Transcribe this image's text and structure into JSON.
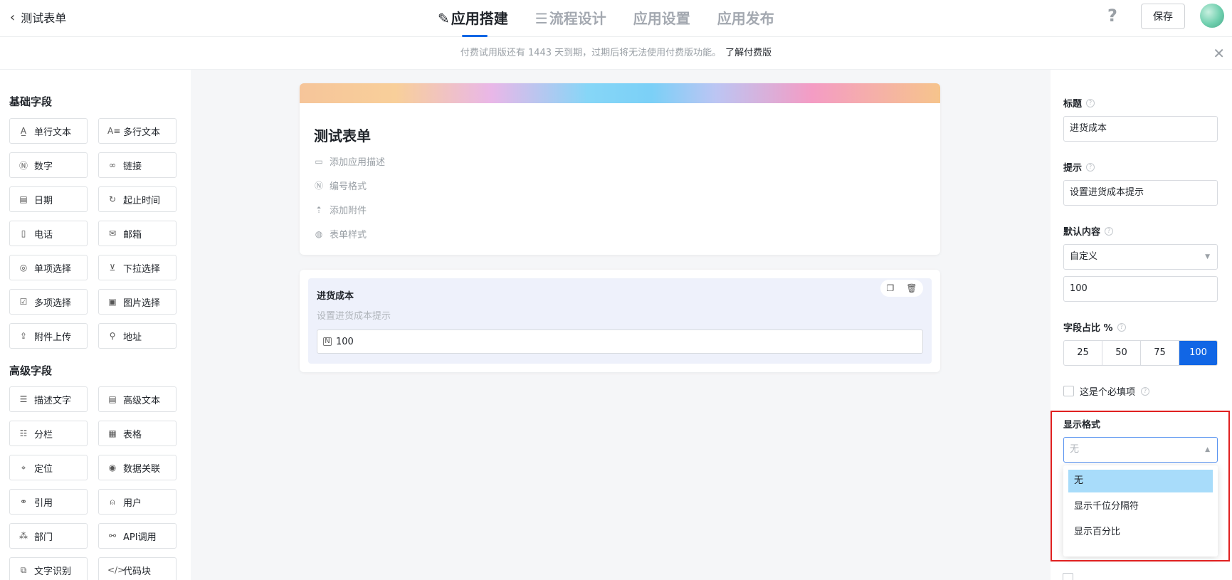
{
  "header": {
    "back_label": "测试表单",
    "tabs": [
      {
        "label": "应用搭建",
        "active": true,
        "icon": "edit-icon"
      },
      {
        "label": "流程设计",
        "active": false,
        "icon": "flow-icon"
      },
      {
        "label": "应用设置",
        "active": false
      },
      {
        "label": "应用发布",
        "active": false
      }
    ],
    "help_label": "?",
    "save_label": "保存"
  },
  "notice": {
    "text": "付费试用版还有 1443 天到期，过期后将无法使用付费版功能。",
    "link": "了解付费版"
  },
  "left_panel": {
    "basic_title": "基础字段",
    "basic_fields": [
      {
        "label": "单行文本",
        "icon": "single-line-text-icon",
        "glyph": "A̲"
      },
      {
        "label": "多行文本",
        "icon": "multi-line-text-icon",
        "glyph": "A≡"
      },
      {
        "label": "数字",
        "icon": "number-icon",
        "glyph": "Ⓝ"
      },
      {
        "label": "链接",
        "icon": "link-icon",
        "glyph": "🔗"
      },
      {
        "label": "日期",
        "icon": "calendar-icon",
        "glyph": "▤"
      },
      {
        "label": "起止时间",
        "icon": "time-range-icon",
        "glyph": "↻"
      },
      {
        "label": "电话",
        "icon": "phone-icon",
        "glyph": "▯"
      },
      {
        "label": "邮箱",
        "icon": "mail-icon",
        "glyph": "✉"
      },
      {
        "label": "单项选择",
        "icon": "radio-icon",
        "glyph": "◎"
      },
      {
        "label": "下拉选择",
        "icon": "dropdown-icon",
        "glyph": "⊻"
      },
      {
        "label": "多项选择",
        "icon": "checkbox-icon",
        "glyph": "☑"
      },
      {
        "label": "图片选择",
        "icon": "image-icon",
        "glyph": "▣"
      },
      {
        "label": "附件上传",
        "icon": "upload-icon",
        "glyph": "⇪"
      },
      {
        "label": "地址",
        "icon": "location-pin-icon",
        "glyph": "⚲"
      }
    ],
    "advanced_title": "高级字段",
    "advanced_fields": [
      {
        "label": "描述文字",
        "icon": "description-icon",
        "glyph": "☰"
      },
      {
        "label": "高级文本",
        "icon": "rich-text-icon",
        "glyph": "▤"
      },
      {
        "label": "分栏",
        "icon": "columns-icon",
        "glyph": "☷"
      },
      {
        "label": "表格",
        "icon": "table-icon",
        "glyph": "▦"
      },
      {
        "label": "定位",
        "icon": "locate-icon",
        "glyph": "⌖"
      },
      {
        "label": "数据关联",
        "icon": "data-link-icon",
        "glyph": "◉"
      },
      {
        "label": "引用",
        "icon": "reference-icon",
        "glyph": "⚭"
      },
      {
        "label": "用户",
        "icon": "user-icon",
        "glyph": "⍝"
      },
      {
        "label": "部门",
        "icon": "department-icon",
        "glyph": "⁂"
      },
      {
        "label": "API调用",
        "icon": "api-icon",
        "glyph": "⚯"
      },
      {
        "label": "文字识别",
        "icon": "ocr-icon",
        "glyph": "⧉"
      },
      {
        "label": "代码块",
        "icon": "code-icon",
        "glyph": "</>"
      }
    ]
  },
  "form": {
    "title": "测试表单",
    "meta": [
      {
        "label": "添加应用描述",
        "icon": "comment-icon",
        "glyph": "▭"
      },
      {
        "label": "编号格式",
        "icon": "number-format-icon",
        "glyph": "Ⓝ"
      },
      {
        "label": "添加附件",
        "icon": "attach-upload-icon",
        "glyph": "⇡"
      },
      {
        "label": "表单样式",
        "icon": "palette-icon",
        "glyph": "◍"
      }
    ],
    "field": {
      "label": "进货成本",
      "hint": "设置进货成本提示",
      "value": "100"
    }
  },
  "right_panel": {
    "title_label": "标题",
    "title_value": "进货成本",
    "hint_label": "提示",
    "hint_value": "设置进货成本提示",
    "default_label": "默认内容",
    "default_mode": "自定义",
    "default_value": "100",
    "ratio_label": "字段占比 %",
    "ratio_options": [
      "25",
      "50",
      "75",
      "100"
    ],
    "ratio_selected": "100",
    "required_label": "这是个必填项",
    "format_label": "显示格式",
    "format_value": "无",
    "format_options": [
      "无",
      "显示千位分隔符",
      "显示百分比"
    ]
  },
  "colors": {
    "accent": "#1166e5",
    "highlight_border": "#e02020",
    "dropdown_selected": "#a8dcfa"
  }
}
